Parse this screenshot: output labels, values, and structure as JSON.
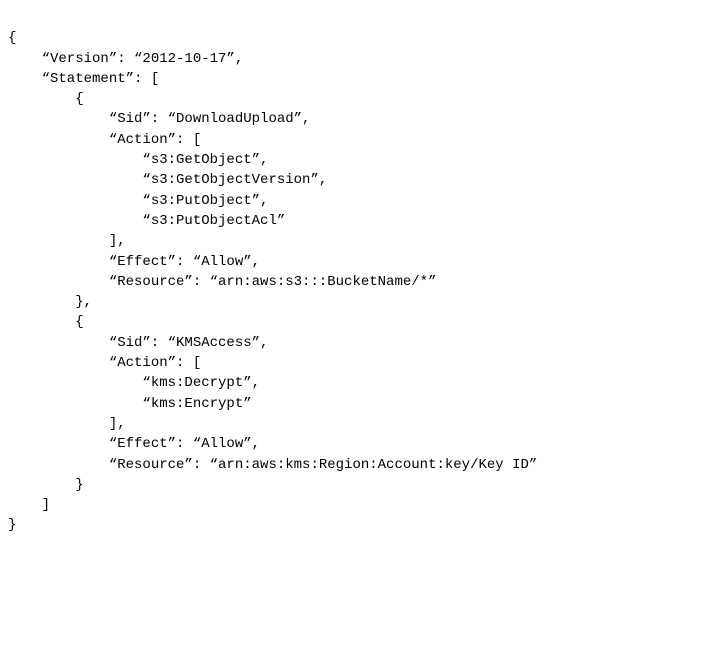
{
  "policy_text": "{\n    “Version”: “2012-10-17”,\n    “Statement”: [\n        {\n            “Sid”: “DownloadUpload”,\n            “Action”: [\n                “s3:GetObject”,\n                “s3:GetObjectVersion”,\n                “s3:PutObject”,\n                “s3:PutObjectAcl”\n            ],\n            “Effect”: “Allow”,\n            “Resource”: “arn:aws:s3:::BucketName/*”\n        },\n        {\n            “Sid”: “KMSAccess”,\n            “Action”: [\n                “kms:Decrypt”,\n                “kms:Encrypt”\n            ],\n            “Effect”: “Allow”,\n            “Resource”: “arn:aws:kms:Region:Account:key/Key ID”\n        }\n    ]\n}",
  "policy": {
    "Version": "2012-10-17",
    "Statement": [
      {
        "Sid": "DownloadUpload",
        "Action": [
          "s3:GetObject",
          "s3:GetObjectVersion",
          "s3:PutObject",
          "s3:PutObjectAcl"
        ],
        "Effect": "Allow",
        "Resource": "arn:aws:s3:::BucketName/*"
      },
      {
        "Sid": "KMSAccess",
        "Action": [
          "kms:Decrypt",
          "kms:Encrypt"
        ],
        "Effect": "Allow",
        "Resource": "arn:aws:kms:Region:Account:key/Key ID"
      }
    ]
  }
}
